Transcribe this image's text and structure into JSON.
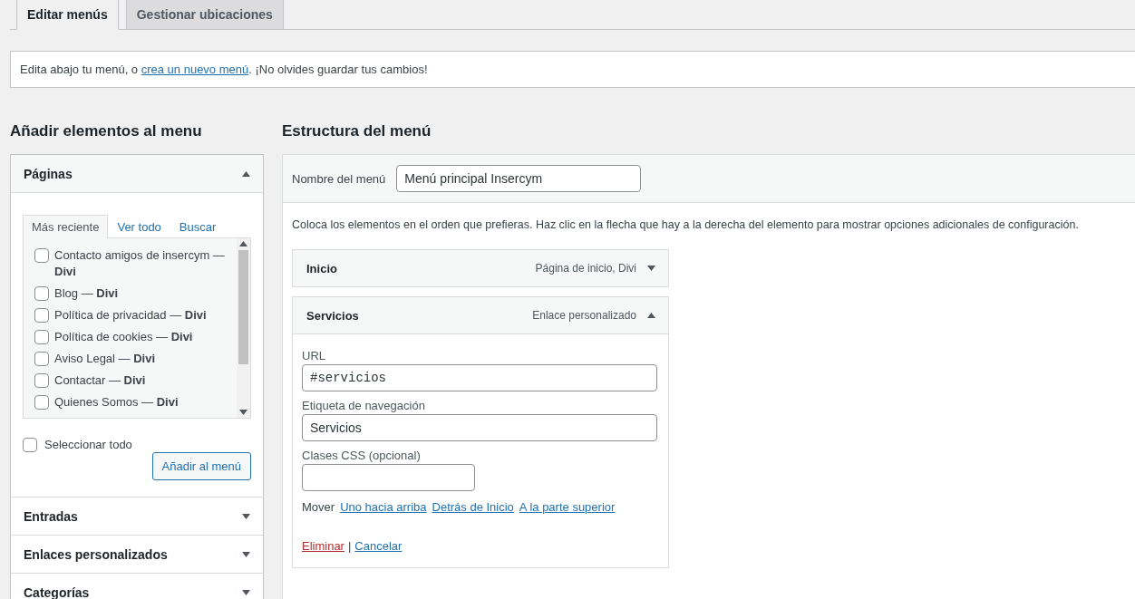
{
  "tabs": [
    {
      "label": "Editar menús",
      "selected": true
    },
    {
      "label": "Gestionar ubicaciones",
      "selected": false
    }
  ],
  "notice": {
    "before": "Edita abajo tu menú, o ",
    "link": "crea un nuevo menú",
    "after": ". ¡No olvides guardar tus cambios!"
  },
  "add_items": {
    "title": "Añadir elementos al menu",
    "sections": [
      {
        "title": "Páginas",
        "expanded": true,
        "subtabs": [
          {
            "label": "Más reciente",
            "selected": true
          },
          {
            "label": "Ver todo",
            "selected": false
          },
          {
            "label": "Buscar",
            "selected": false
          }
        ],
        "pages": [
          {
            "label": "Contacto amigos de insercym — **Divi**",
            "checked": false
          },
          {
            "label": "Blog — **Divi**",
            "checked": false
          },
          {
            "label": "Política de privacidad — **Divi**",
            "checked": false
          },
          {
            "label": "Política de cookies — **Divi**",
            "checked": false
          },
          {
            "label": "Aviso Legal — **Divi**",
            "checked": false
          },
          {
            "label": "Contactar — **Divi**",
            "checked": false
          },
          {
            "label": "Quienes Somos — **Divi**",
            "checked": false
          }
        ],
        "select_all": {
          "label": "Seleccionar todo",
          "checked": false
        },
        "button": "Añadir al menú"
      },
      {
        "title": "Entradas",
        "expanded": false
      },
      {
        "title": "Enlaces personalizados",
        "expanded": false
      },
      {
        "title": "Categorías",
        "expanded": false
      }
    ]
  },
  "structure": {
    "title": "Estructura del menú",
    "name_label": "Nombre del menú",
    "name_value": "Menú principal Insercym",
    "instructions": "Coloca los elementos en el orden que prefieras. Haz clic en la flecha que hay a la derecha del elemento para mostrar opciones adicionales de configuración.",
    "items": [
      {
        "title": "Inicio",
        "type": "Página de inicio, Divi",
        "expanded": false
      },
      {
        "title": "Servicios",
        "type": "Enlace personalizado",
        "expanded": true,
        "fields": [
          {
            "label": "URL",
            "value": "#servicios",
            "kind": "mono"
          },
          {
            "label": "Etiqueta de navegación",
            "value": "Servicios",
            "kind": "wide"
          },
          {
            "label": "Clases CSS (opcional)",
            "kind": "short"
          }
        ],
        "move_label": "Mover",
        "move_links": [
          "Uno hacia arriba",
          "Detrás de Inicio",
          "A la parte superior"
        ],
        "delete": "Eliminar",
        "separator": "|",
        "cancel": "Cancelar"
      }
    ]
  }
}
